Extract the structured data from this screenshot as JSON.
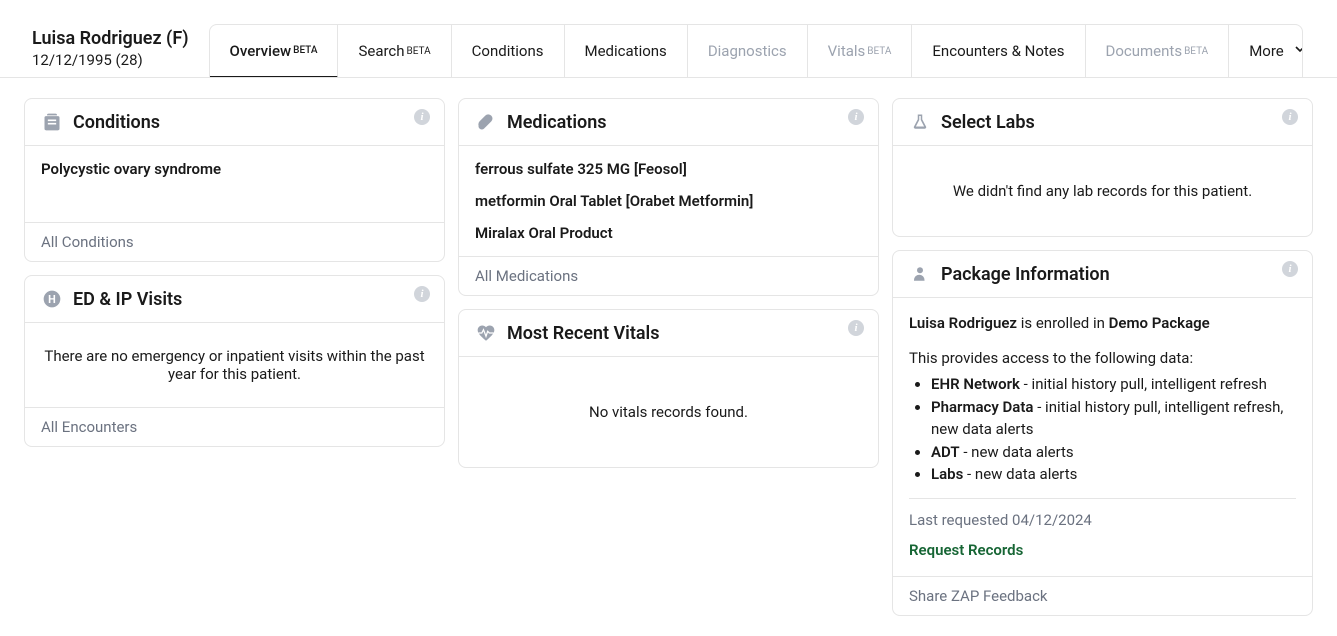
{
  "patient": {
    "name": "Luisa Rodriguez (F)",
    "dob_age": "12/12/1995 (28)"
  },
  "tabs": {
    "overview": "Overview",
    "overview_badge": "BETA",
    "search": "Search",
    "search_badge": "BETA",
    "conditions": "Conditions",
    "medications": "Medications",
    "diagnostics": "Diagnostics",
    "vitals": "Vitals",
    "vitals_badge": "BETA",
    "encounters": "Encounters & Notes",
    "documents": "Documents",
    "documents_badge": "BETA",
    "more": "More"
  },
  "cards": {
    "conditions": {
      "title": "Conditions",
      "items": [
        "Polycystic ovary syndrome"
      ],
      "footer": "All Conditions"
    },
    "ed_ip": {
      "title": "ED & IP Visits",
      "empty": "There are no emergency or inpatient visits within the past year for this patient.",
      "footer": "All Encounters"
    },
    "medications": {
      "title": "Medications",
      "items": [
        "ferrous sulfate 325 MG [Feosol]",
        "metformin Oral Tablet [Orabet Metformin]",
        "Miralax Oral Product"
      ],
      "footer": "All Medications"
    },
    "vitals": {
      "title": "Most Recent Vitals",
      "empty": "No vitals records found."
    },
    "labs": {
      "title": "Select Labs",
      "empty": "We didn't find any lab records for this patient."
    },
    "package": {
      "title": "Package Information",
      "intro_name": "Luisa Rodriguez",
      "intro_mid": " is enrolled in ",
      "intro_pkg": "Demo Package",
      "access_text": "This provides access to the following data:",
      "items": [
        {
          "name": "EHR Network",
          "desc": " - initial history pull, intelligent refresh"
        },
        {
          "name": "Pharmacy Data",
          "desc": " - initial history pull, intelligent refresh, new data alerts"
        },
        {
          "name": "ADT",
          "desc": " - new data alerts"
        },
        {
          "name": "Labs",
          "desc": " - new data alerts"
        }
      ],
      "last_requested": "Last requested 04/12/2024",
      "request_records": "Request Records",
      "share_feedback": "Share ZAP Feedback"
    }
  }
}
